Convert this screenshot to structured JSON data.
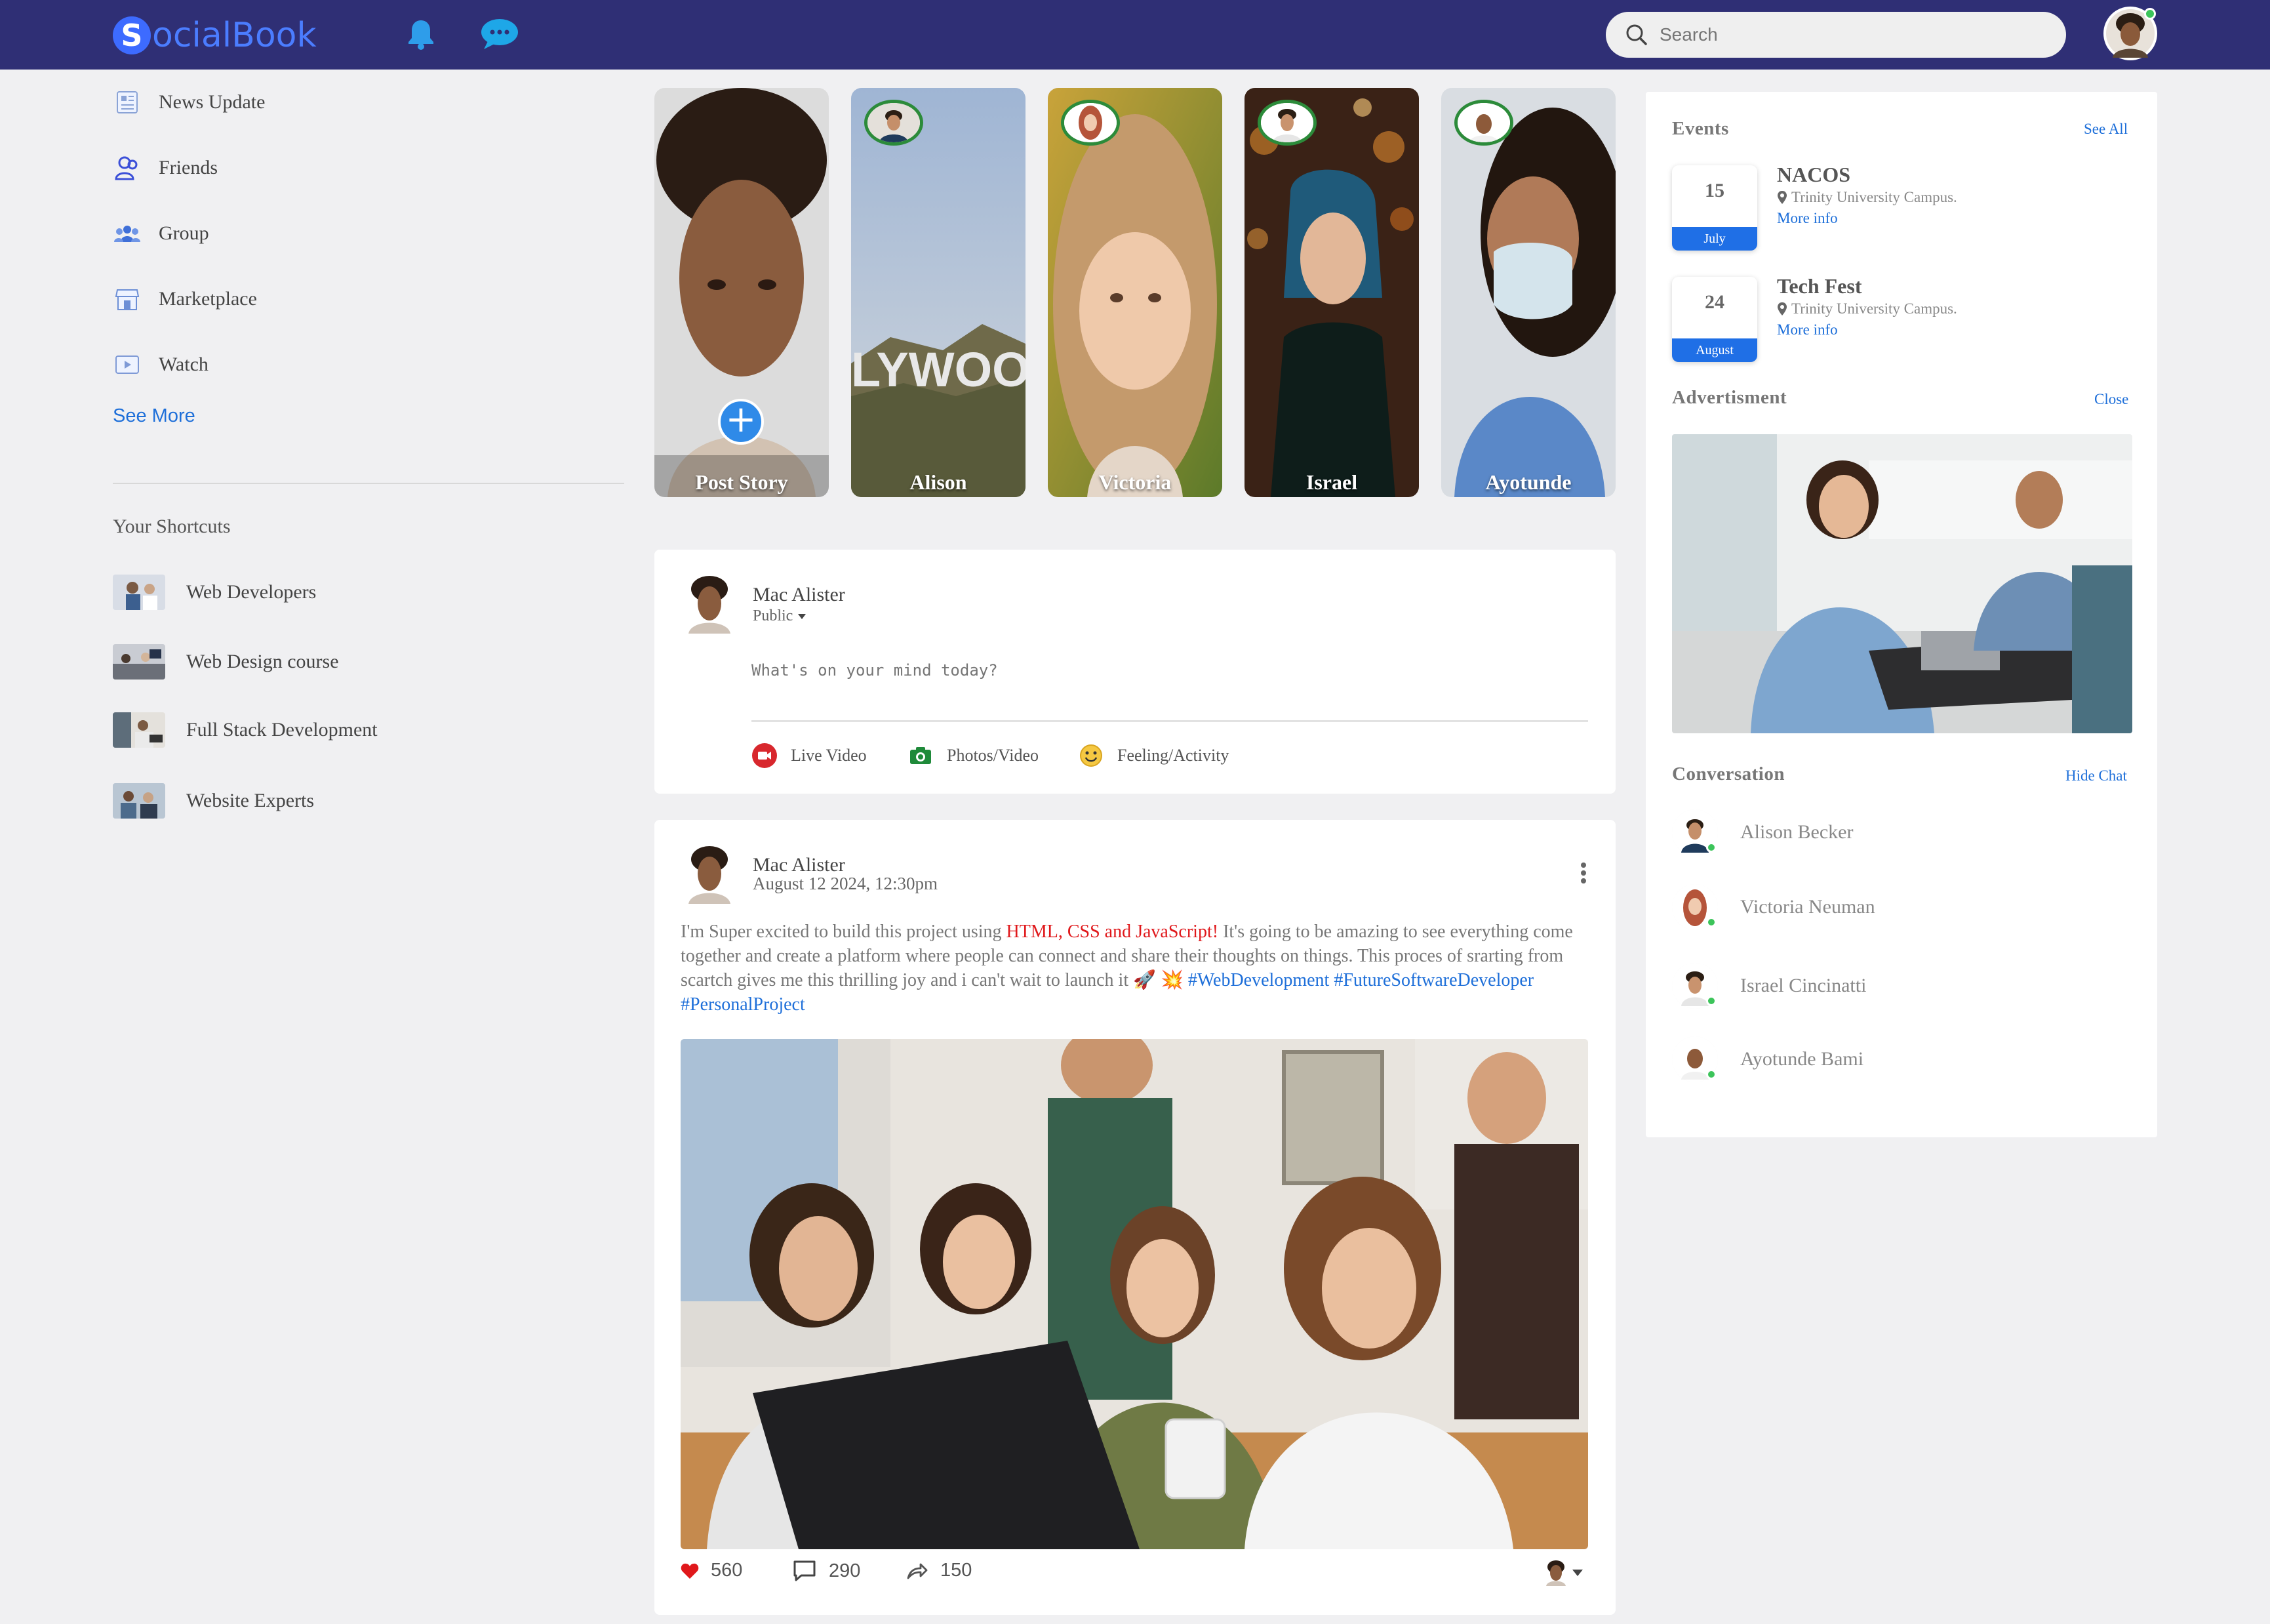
{
  "app": {
    "logo_letter": "S",
    "logo_text": "ocialBook",
    "brand_color": "#2f2f75",
    "accent_color": "#1e6fd9"
  },
  "header": {
    "notification_icon": "bell-icon",
    "message_icon": "chat-bubble-icon",
    "search": {
      "placeholder": "Search",
      "value": ""
    },
    "profile_icon": "user-avatar"
  },
  "sidebar": {
    "items": [
      {
        "label": "News Update",
        "icon": "newspaper-icon"
      },
      {
        "label": "Friends",
        "icon": "friends-icon"
      },
      {
        "label": "Group",
        "icon": "group-icon"
      },
      {
        "label": "Marketplace",
        "icon": "store-icon"
      },
      {
        "label": "Watch",
        "icon": "play-icon"
      }
    ],
    "see_more": "See More",
    "shortcuts_title": "Your Shortcuts",
    "shortcuts": [
      {
        "label": "Web Developers"
      },
      {
        "label": "Web Design course"
      },
      {
        "label": "Full Stack Development"
      },
      {
        "label": "Website Experts"
      }
    ]
  },
  "stories": [
    {
      "label": "Post Story"
    },
    {
      "label": "Alison"
    },
    {
      "label": "Victoria"
    },
    {
      "label": "Israel"
    },
    {
      "label": "Ayotunde"
    }
  ],
  "composer": {
    "user_name": "Mac Alister",
    "privacy": "Public",
    "placeholder": "What's on your mind today?",
    "actions": [
      {
        "label": "Live Video",
        "icon": "live-video-icon"
      },
      {
        "label": "Photos/Video",
        "icon": "camera-icon"
      },
      {
        "label": "Feeling/Activity",
        "icon": "smiley-icon"
      }
    ]
  },
  "post": {
    "user_name": "Mac Alister",
    "timestamp": "August 12 2024, 12:30pm",
    "text_before": "I'm Super excited to build this project using ",
    "text_highlight": "HTML, CSS and JavaScript!",
    "text_after": " It's going to be amazing to see everything come together and create a platform where people can connect and share their thoughts on things. This proces of srarting from scartch gives me this thrilling joy and i can't wait to launch it 🚀 💥 ",
    "hashtags": [
      "#WebDevelopment",
      "#FutureSoftwareDeveloper",
      "#PersonalProject"
    ],
    "likes": "560",
    "comments": "290",
    "shares": "150"
  },
  "events": {
    "title": "Events",
    "see_all": "See All",
    "items": [
      {
        "day": "15",
        "month": "July",
        "name": "NACOS",
        "place": "Trinity University Campus.",
        "more": "More info"
      },
      {
        "day": "24",
        "month": "August",
        "name": "Tech Fest",
        "place": "Trinity University Campus.",
        "more": "More info"
      }
    ]
  },
  "advertisment": {
    "title": "Advertisment",
    "close": "Close"
  },
  "conversation": {
    "title": "Conversation",
    "hide": "Hide Chat",
    "contacts": [
      {
        "name": "Alison Becker"
      },
      {
        "name": "Victoria Neuman"
      },
      {
        "name": "Israel Cincinatti"
      },
      {
        "name": "Ayotunde Bami"
      }
    ]
  }
}
